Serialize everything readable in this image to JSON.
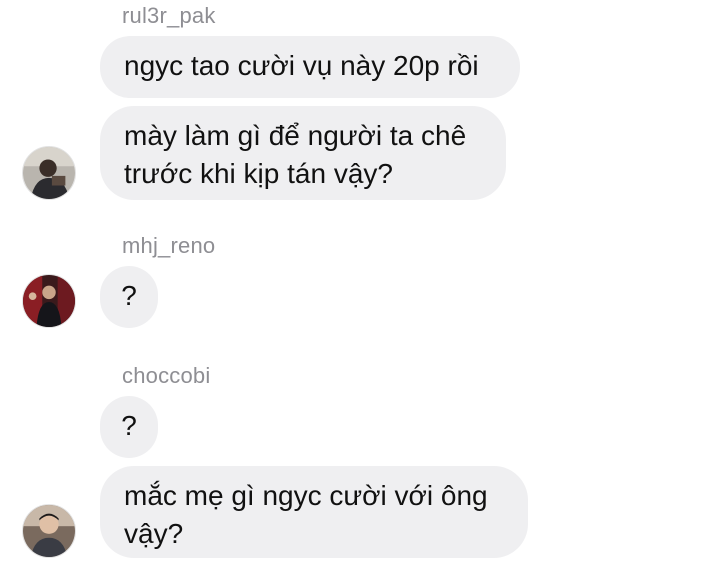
{
  "messages": [
    {
      "username": "rul3r_pak",
      "bubbles": [
        "ngyc tao cười vụ này 20p rồi",
        "mày làm gì để người ta chê\ntrước khi kịp tán vậy?"
      ]
    },
    {
      "username": "mhj_reno",
      "bubbles": [
        "?"
      ]
    },
    {
      "username": "choccobi",
      "bubbles": [
        "?",
        "mắc mẹ gì ngyc cười với ông\nvậy?"
      ]
    }
  ]
}
